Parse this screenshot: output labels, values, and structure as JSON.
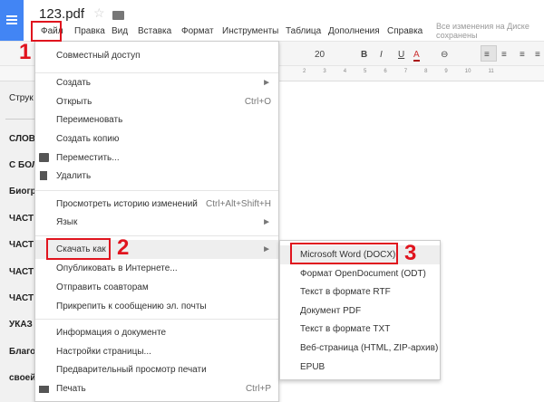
{
  "header": {
    "title": "123.pdf",
    "status": "Все изменения на Диске сохранены"
  },
  "menubar": [
    "Файл",
    "Правка",
    "Вид",
    "Вставка",
    "Формат",
    "Инструменты",
    "Таблица",
    "Дополнения",
    "Справка"
  ],
  "toolbar": {
    "font_size": "20",
    "bold": "B",
    "italic": "I",
    "underline": "U",
    "text_color": "A"
  },
  "ruler": [
    "2",
    "3",
    "4",
    "5",
    "6",
    "7",
    "8",
    "9",
    "10",
    "11"
  ],
  "outline": [
    "Струк",
    "СЛОВ",
    "С БОЛ",
    "Биогр",
    "ЧАСТ",
    "ЧАСТ",
    "ЧАСТ",
    "ЧАСТ",
    "УКАЗ",
    "Благо",
    "своей"
  ],
  "file_menu": {
    "share": "Совместный доступ",
    "group1": [
      {
        "label": "Создать",
        "shortcut": "►"
      },
      {
        "label": "Открыть",
        "shortcut": "Ctrl+O"
      },
      {
        "label": "Переименовать"
      },
      {
        "label": "Создать копию"
      },
      {
        "label": "Переместить..."
      },
      {
        "label": "Удалить"
      }
    ],
    "group2": [
      {
        "label": "Просмотреть историю изменений",
        "shortcut": "Ctrl+Alt+Shift+H"
      },
      {
        "label": "Язык",
        "shortcut": "►"
      }
    ],
    "group3": [
      {
        "label": "Скачать как",
        "shortcut": "►"
      },
      {
        "label": "Опубликовать в Интернете..."
      },
      {
        "label": "Отправить соавторам"
      },
      {
        "label": "Прикрепить к сообщению эл. почты"
      }
    ],
    "group4": [
      {
        "label": "Информация о документе"
      },
      {
        "label": "Настройки страницы..."
      },
      {
        "label": "Предварительный просмотр печати"
      },
      {
        "label": "Печать",
        "shortcut": "Ctrl+P"
      }
    ]
  },
  "download_submenu": [
    "Microsoft Word (DOCX)",
    "Формат OpenDocument (ODT)",
    "Текст в формате RTF",
    "Документ PDF",
    "Текст в формате TXT",
    "Веб-страница (HTML, ZIP-архив)",
    "EPUB"
  ],
  "annotations": [
    "1",
    "2",
    "3"
  ],
  "colors": {
    "accent": "#4285f4",
    "annotation": "#e0141e"
  }
}
